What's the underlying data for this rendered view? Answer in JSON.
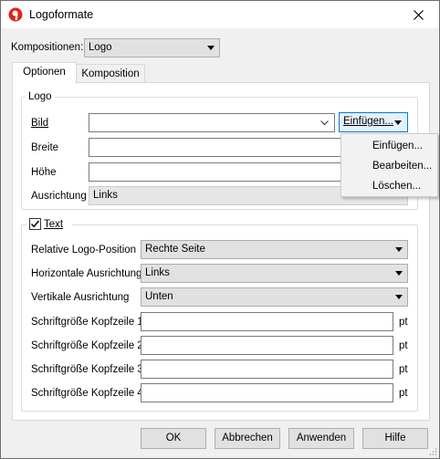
{
  "window": {
    "title": "Logoformate"
  },
  "kompositionen": {
    "label": "Kompositionen:",
    "value": "Logo"
  },
  "tabs": [
    {
      "label": "Optionen"
    },
    {
      "label": "Komposition"
    }
  ],
  "logo_group": {
    "title": "Logo",
    "bild_label": "Bild",
    "bild_value": "",
    "einfugen_button": "Einfügen...",
    "breite_label": "Breite",
    "hohe_label": "Höhe",
    "ausrichtung_label": "Ausrichtung",
    "ausrichtung_value": "Links"
  },
  "dropdown_menu": {
    "items": [
      "Einfügen...",
      "Bearbeiten...",
      "Löschen..."
    ]
  },
  "text_group": {
    "title": "Text",
    "checked": true,
    "fields": [
      {
        "label": "Relative Logo-Position",
        "value": "Rechte Seite"
      },
      {
        "label": "Horizontale Ausrichtung",
        "value": "Links"
      },
      {
        "label": "Vertikale Ausrichtung",
        "value": "Unten"
      }
    ],
    "font_sizes": [
      {
        "label": "Schriftgröße Kopfzeile 1",
        "value": "",
        "unit": "pt"
      },
      {
        "label": "Schriftgröße Kopfzeile 2",
        "value": "",
        "unit": "pt"
      },
      {
        "label": "Schriftgröße Kopfzeile 3",
        "value": "",
        "unit": "pt"
      },
      {
        "label": "Schriftgröße Kopfzeile 4",
        "value": "",
        "unit": "pt"
      }
    ]
  },
  "buttons": {
    "ok": "OK",
    "cancel": "Abbrechen",
    "apply": "Anwenden",
    "help": "Hilfe"
  },
  "colors": {
    "accent": "#0078d7",
    "app_icon": "#e2231a"
  },
  "icons": {
    "app": "banana-logo-icon",
    "close": "close-icon"
  }
}
